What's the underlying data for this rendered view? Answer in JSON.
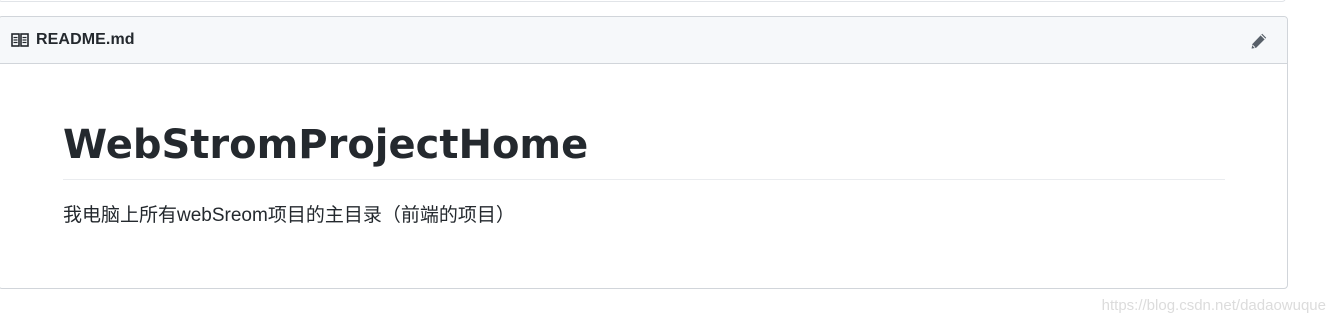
{
  "readme": {
    "filename": "README.md",
    "book_icon": "book-icon",
    "edit_icon": "pencil-icon",
    "heading": "WebStromProjectHome",
    "paragraph": "我电脑上所有webSreom项目的主目录（前端的项目）"
  },
  "watermark": "https://blog.csdn.net/dadaowuque",
  "colors": {
    "header_bg": "#f6f8fa",
    "border": "#d1d5da",
    "text": "#24292e",
    "icon": "#586069",
    "divider": "#eaecef"
  }
}
